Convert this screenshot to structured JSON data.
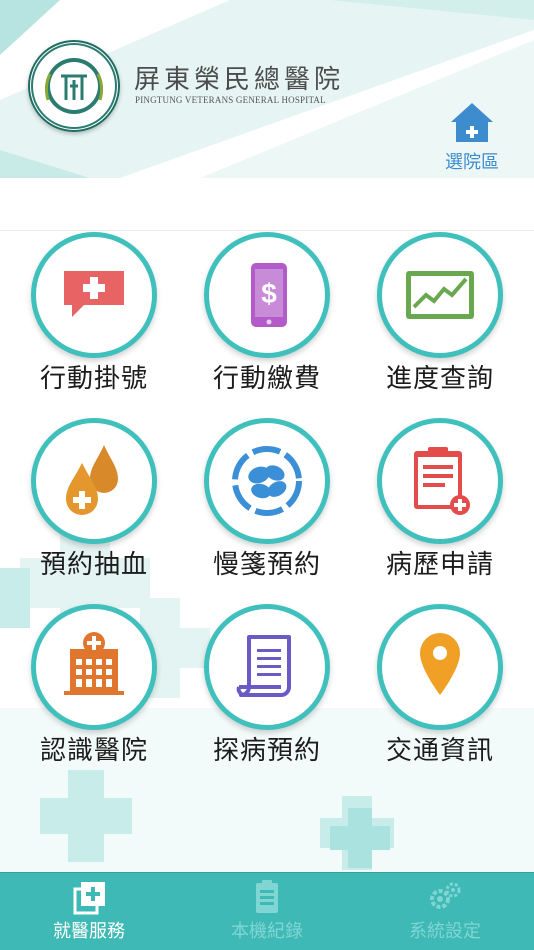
{
  "header": {
    "hospital_name": "屏東榮民總醫院",
    "hospital_name_en": "PINGTUNG VETERANS GENERAL HOSPITAL",
    "region_button_label": "選院區",
    "logo_text": "PINGTUNG VETERANS GENERAL HOSPITAL"
  },
  "services": [
    {
      "label": "行動掛號",
      "icon": "medical-cross-chat-icon"
    },
    {
      "label": "行動繳費",
      "icon": "mobile-payment-icon"
    },
    {
      "label": "進度查詢",
      "icon": "progress-chart-icon"
    },
    {
      "label": "預約抽血",
      "icon": "blood-drop-icon"
    },
    {
      "label": "慢箋預約",
      "icon": "pills-icon"
    },
    {
      "label": "病歷申請",
      "icon": "medical-record-icon"
    },
    {
      "label": "認識醫院",
      "icon": "hospital-building-icon"
    },
    {
      "label": "探病預約",
      "icon": "document-icon"
    },
    {
      "label": "交通資訊",
      "icon": "location-pin-icon"
    }
  ],
  "tabs": [
    {
      "label": "就醫服務",
      "icon": "medical-service-icon",
      "active": true
    },
    {
      "label": "本機紀錄",
      "icon": "clipboard-icon",
      "active": false
    },
    {
      "label": "系統設定",
      "icon": "gears-icon",
      "active": false
    }
  ],
  "colors": {
    "accent": "#40c0bc",
    "tabbar": "#3fb9b5",
    "region": "#3d8ccd"
  }
}
